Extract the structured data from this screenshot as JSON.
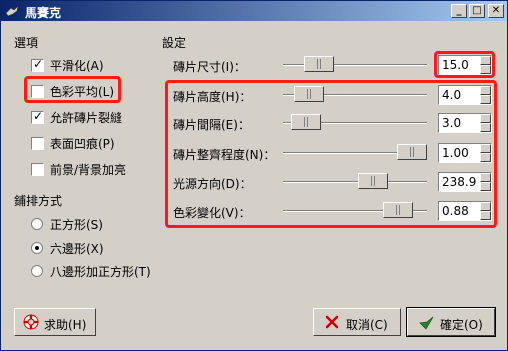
{
  "window": {
    "title": "馬賽克",
    "min_label": "_",
    "max_label": "□",
    "close_label": "✕"
  },
  "options": {
    "heading": "選項",
    "items": [
      {
        "label": "平滑化(A)",
        "checked": true
      },
      {
        "label": "色彩平均(L)",
        "checked": false
      },
      {
        "label": "允許磚片裂縫",
        "checked": true
      },
      {
        "label": "表面凹痕(P)",
        "checked": false
      },
      {
        "label": "前景/背景加亮",
        "checked": false
      }
    ]
  },
  "tiling": {
    "heading": "鋪排方式",
    "items": [
      {
        "label": "正方形(S)",
        "selected": false
      },
      {
        "label": "六邊形(X)",
        "selected": true
      },
      {
        "label": "八邊形加正方形(T)",
        "selected": false
      }
    ]
  },
  "settings": {
    "heading": "設定",
    "sliders": [
      {
        "label": "磚片尺寸(I)：",
        "value": "15.0",
        "level": 0.18
      },
      {
        "label": "磚片高度(H)：",
        "value": "4.0",
        "level": 0.1
      },
      {
        "label": "磚片間隔(E)：",
        "value": "3.0",
        "level": 0.07
      },
      {
        "label": "磚片整齊程度(N)：",
        "value": "1.00",
        "level": 1.0
      },
      {
        "label": "光源方向(D)：",
        "value": "238.9",
        "level": 0.66
      },
      {
        "label": "色彩變化(V)：",
        "value": "0.88",
        "level": 0.88
      }
    ]
  },
  "buttons": {
    "help": "求助(H)",
    "cancel": "取消(C)",
    "ok": "確定(O)"
  },
  "colors": {
    "highlight": "#ff1a1a",
    "title_start": "#0a246a",
    "title_end": "#a6caf0"
  }
}
